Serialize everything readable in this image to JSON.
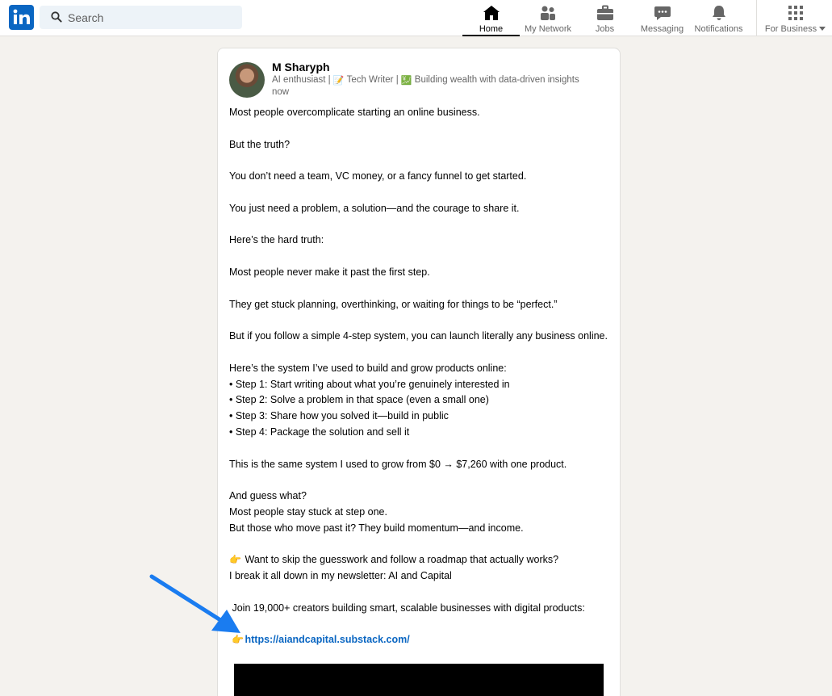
{
  "nav": {
    "search_placeholder": "Search",
    "items": [
      {
        "label": "Home",
        "icon": "home-icon",
        "active": true
      },
      {
        "label": "My Network",
        "icon": "network-icon"
      },
      {
        "label": "Jobs",
        "icon": "briefcase-icon"
      },
      {
        "label": "Messaging",
        "icon": "messaging-icon"
      },
      {
        "label": "Notifications",
        "icon": "bell-icon"
      },
      {
        "label": "For Business",
        "icon": "grid-icon"
      }
    ]
  },
  "post": {
    "author": "M Sharyph",
    "headline": {
      "part1": "AI enthusiast | ",
      "part2": " Tech Writer | ",
      "part3": " Building wealth with data-driven insights"
    },
    "time": "now",
    "lines": {
      "l1": "Most people overcomplicate starting an online business.",
      "l2": "But the truth?",
      "l3": "You don’t need a team, VC money, or a fancy funnel to get started.",
      "l4": "You just need a problem, a solution—and the courage to share it.",
      "l5": "Here’s the hard truth:",
      "l6": "Most people never make it past the first step.",
      "l7": "They get stuck planning, overthinking, or waiting for things to be “perfect.”",
      "l8": "But if you follow a simple 4-step system, you can launch literally any business online.",
      "l9": "Here’s the system I’ve used to build and grow products online:",
      "s1": "• Step 1: Start writing about what you’re genuinely interested in",
      "s2": "• Step 2: Solve a problem in that space (even a small one)",
      "s3": "• Step 3: Share how you solved it—build in public",
      "s4": "• Step 4: Package the solution and sell it",
      "l10": "This is the same system I used to grow from $0 → $7,260 with one product.",
      "l11": "And guess what?",
      "l12": "Most people stay stuck at step one.",
      "l13": "But those who move past it? They build momentum—and income.",
      "l14": "Want to skip the guesswork and follow a roadmap that actually works?",
      "l15": "I break it all down in my newsletter: AI and Capital",
      "l16": "Join 19,000+ creators building smart, scalable businesses with digital products:",
      "link": "https://aiandcapital.substack.com/"
    }
  },
  "colors": {
    "brand": "#0a66c2",
    "annotation_arrow": "#1a7cf0",
    "page_bg": "#f4f2ee"
  }
}
